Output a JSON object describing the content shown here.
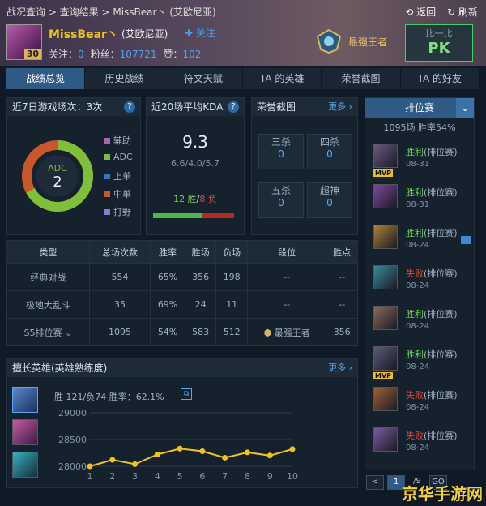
{
  "header": {
    "breadcrumb": "战况查询 > 查询结果 > MissBear丶 (艾欧尼亚)",
    "back": "返回",
    "refresh": "刷新",
    "username": "MissBear丶",
    "server": "(艾欧尼亚)",
    "follow": "关注",
    "level": "30",
    "stats": {
      "follow_label": "关注：",
      "follow_val": "0",
      "fans_label": "粉丝：",
      "fans_val": "107721",
      "likes_label": "赞：",
      "likes_val": "102"
    },
    "rank": "最强王者",
    "pk_small": "比一比",
    "pk_big": "PK"
  },
  "tabs": [
    "战绩总览",
    "历史战绩",
    "符文天赋",
    "TA 的英雄",
    "荣誉截图",
    "TA 的好友"
  ],
  "recent": {
    "title": "近7日游戏场次：3次",
    "ring_role": "ADC",
    "ring_count": "2",
    "legend": [
      "辅助",
      "ADC",
      "上单",
      "中单",
      "打野"
    ],
    "legend_colors": [
      "#a06ab0",
      "#7fbf3a",
      "#2e78c6",
      "#c8582a",
      "#8a7ad0"
    ]
  },
  "kda": {
    "title": "近20场平均KDA",
    "value": "9.3",
    "detail": "6.6/4.0/5.7",
    "wins": "12 胜",
    "sep": "/",
    "losses": "8 负",
    "win_ratio": 0.6
  },
  "honor": {
    "title": "荣誉截图",
    "more": "更多",
    "cells": [
      {
        "label": "三杀",
        "count": "0"
      },
      {
        "label": "四杀",
        "count": "0"
      },
      {
        "label": "五杀",
        "count": "0"
      },
      {
        "label": "超神",
        "count": "0"
      }
    ]
  },
  "modes": {
    "headers": [
      "类型",
      "总场次数",
      "胜率",
      "胜场",
      "负场",
      "段位",
      "胜点"
    ],
    "rows": [
      {
        "type": "经典对战",
        "total": "554",
        "rate": "65%",
        "win": "356",
        "lose": "198",
        "rank": "--",
        "pts": "--"
      },
      {
        "type": "极地大乱斗",
        "total": "35",
        "rate": "69%",
        "win": "24",
        "lose": "11",
        "rank": "--",
        "pts": "--"
      },
      {
        "type": "S5排位赛",
        "total": "1095",
        "rate": "54%",
        "win": "583",
        "lose": "512",
        "rank": "最强王者",
        "pts": "356"
      }
    ]
  },
  "heroes": {
    "title": "擅长英雄(英雄熟练度)",
    "more": "更多",
    "summary": "胜 121/负74   胜率：62.1%"
  },
  "chart_data": {
    "type": "line",
    "x": [
      1,
      2,
      3,
      4,
      5,
      6,
      7,
      8,
      9,
      10
    ],
    "y": [
      28000,
      28120,
      28040,
      28220,
      28330,
      28280,
      28160,
      28260,
      28200,
      28320
    ],
    "yticks": [
      "29000",
      "28500",
      "28000"
    ],
    "ylim": [
      28000,
      29000
    ],
    "series_color": "#f0c420"
  },
  "ranked": {
    "title": "排位赛",
    "summary": "1095场   胜率54%",
    "matches": [
      {
        "result": "胜利",
        "mode": "(排位赛)",
        "date": "08-31",
        "win": true,
        "mvp": "MVP"
      },
      {
        "result": "胜利",
        "mode": "(排位赛)",
        "date": "08-31",
        "win": true,
        "mvp": ""
      },
      {
        "result": "胜利",
        "mode": "(排位赛)",
        "date": "08-24",
        "win": true,
        "mvp": ""
      },
      {
        "result": "失败",
        "mode": "(排位赛)",
        "date": "08-24",
        "win": false,
        "mvp": ""
      },
      {
        "result": "胜利",
        "mode": "(排位赛)",
        "date": "08-24",
        "win": true,
        "mvp": ""
      },
      {
        "result": "胜利",
        "mode": "(排位赛)",
        "date": "08-24",
        "win": true,
        "mvp": "MVP"
      },
      {
        "result": "失败",
        "mode": "(排位赛)",
        "date": "08-24",
        "win": false,
        "mvp": ""
      },
      {
        "result": "失败",
        "mode": "(排位赛)",
        "date": "08-24",
        "win": false,
        "mvp": ""
      }
    ],
    "pager": [
      "<",
      "1",
      "/9",
      "GO"
    ]
  },
  "watermark": "京华手游网"
}
